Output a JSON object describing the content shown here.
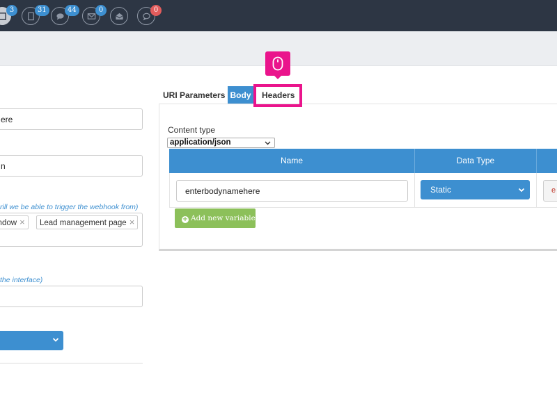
{
  "topbar": {
    "badges": [
      {
        "icon": "gallery-icon",
        "count": "3",
        "color": "#3d8fd0"
      },
      {
        "icon": "document-icon",
        "count": "31",
        "color": "#3d8fd0"
      },
      {
        "icon": "chat-icon",
        "count": "44",
        "color": "#3d8fd0"
      },
      {
        "icon": "mail-icon",
        "count": "0",
        "color": "#3d8fd0"
      },
      {
        "icon": "open-mail-icon",
        "count": null,
        "color": null
      },
      {
        "icon": "comment-icon",
        "count": "0",
        "color": "#e25c5c"
      }
    ]
  },
  "left_form": {
    "field1_value": "ere",
    "field2_value": "n",
    "trigger_hint": "rill we be able to trigger the webhook from)",
    "tags": [
      "indow",
      "Lead management page"
    ],
    "interface_hint": " the interface)",
    "field3_value": ""
  },
  "tabs": {
    "uri_parameters": "URI Parameters",
    "body": "Body",
    "headers": "Headers"
  },
  "body_panel": {
    "content_type_label": "Content type",
    "content_type_value": "application/json",
    "columns": [
      "Name",
      "Data Type"
    ],
    "rows": [
      {
        "name": "enterbodynamehere",
        "data_type": "Static",
        "action_label": "e"
      }
    ],
    "add_variable_label": "Add new variable"
  },
  "colors": {
    "accent": "#3d8fd0",
    "success": "#8cc05a",
    "highlight": "#ea148c",
    "topbar": "#2d3644"
  }
}
